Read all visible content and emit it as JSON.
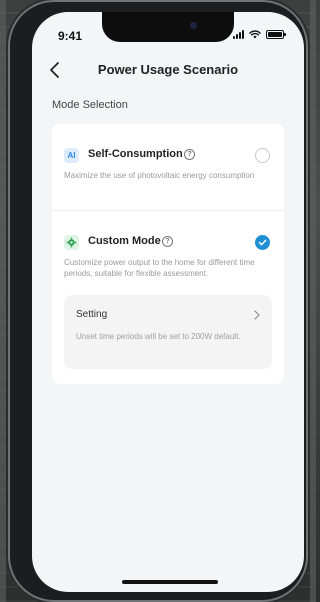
{
  "status_bar": {
    "time": "9:41"
  },
  "header": {
    "title": "Power Usage Scenario",
    "back_icon": "chevron-left-icon"
  },
  "section": {
    "label": "Mode Selection"
  },
  "options": [
    {
      "badge": "AI",
      "title": "Self-Consumption",
      "help": "?",
      "description": "Maximize the use of photovoltaic energy consumption",
      "selected": false
    },
    {
      "badge_icon": "gear-icon",
      "title": "Custom Mode",
      "help": "?",
      "description": "Customize power output to the home for different time periods, suitable for flexible assessment.",
      "selected": true,
      "setting": {
        "label": "Setting",
        "description": "Unset time periods will be set to 200W default."
      }
    }
  ],
  "colors": {
    "accent": "#1f8fd6",
    "ai_badge": "#2f8de4",
    "custom_badge": "#2fa34f"
  }
}
